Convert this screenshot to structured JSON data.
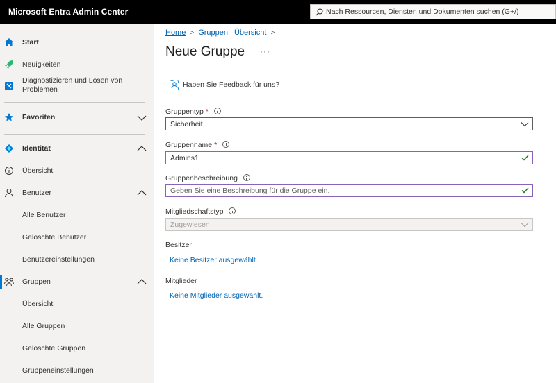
{
  "app": {
    "title": "Microsoft Entra Admin Center"
  },
  "search": {
    "placeholder": "Nach Ressourcen, Diensten und Dokumenten suchen (G+/)"
  },
  "sidebar": {
    "start": "Start",
    "news": "Neuigkeiten",
    "diagnose": "Diagnostizieren und Lösen von Problemen",
    "favorites": "Favoriten",
    "identity": "Identität",
    "overview": "Übersicht",
    "users": "Benutzer",
    "all_users": "Alle Benutzer",
    "deleted_users": "Gelöschte Benutzer",
    "user_settings": "Benutzereinstellungen",
    "groups": "Gruppen",
    "groups_overview": "Übersicht",
    "all_groups": "Alle Gruppen",
    "deleted_groups": "Gelöschte Gruppen",
    "group_settings": "Gruppeneinstellungen"
  },
  "breadcrumb": {
    "home": "Home",
    "groups_overview": "Gruppen | Übersicht"
  },
  "page": {
    "title": "Neue Gruppe",
    "more": "···",
    "feedback": "Haben Sie Feedback für uns?"
  },
  "form": {
    "group_type_label": "Gruppentyp",
    "group_type_value": "Sicherheit",
    "group_name_label": "Gruppenname",
    "group_name_value": "Admins1",
    "group_desc_label": "Gruppenbeschreibung",
    "group_desc_placeholder": "Geben Sie eine Beschreibung für die Gruppe ein.",
    "membership_label": "Mitgliedschaftstyp",
    "membership_value": "Zugewiesen",
    "required_mark": "*",
    "owners_label": "Besitzer",
    "owners_link": "Keine Besitzer ausgewählt.",
    "members_label": "Mitglieder",
    "members_link": "Keine Mitglieder ausgewählt."
  },
  "colors": {
    "accent": "#0078d4",
    "link": "#0063b1",
    "required": "#a4262c",
    "valid": "#107c10",
    "focus": "#8764b8"
  },
  "icons": [
    "search-icon",
    "home-icon",
    "rocket-icon",
    "diagnose-icon",
    "star-icon",
    "identity-icon",
    "info-icon",
    "user-icon",
    "group-icon",
    "chevron-down-icon",
    "chevron-up-icon",
    "feedback-icon",
    "checkmark-icon"
  ]
}
